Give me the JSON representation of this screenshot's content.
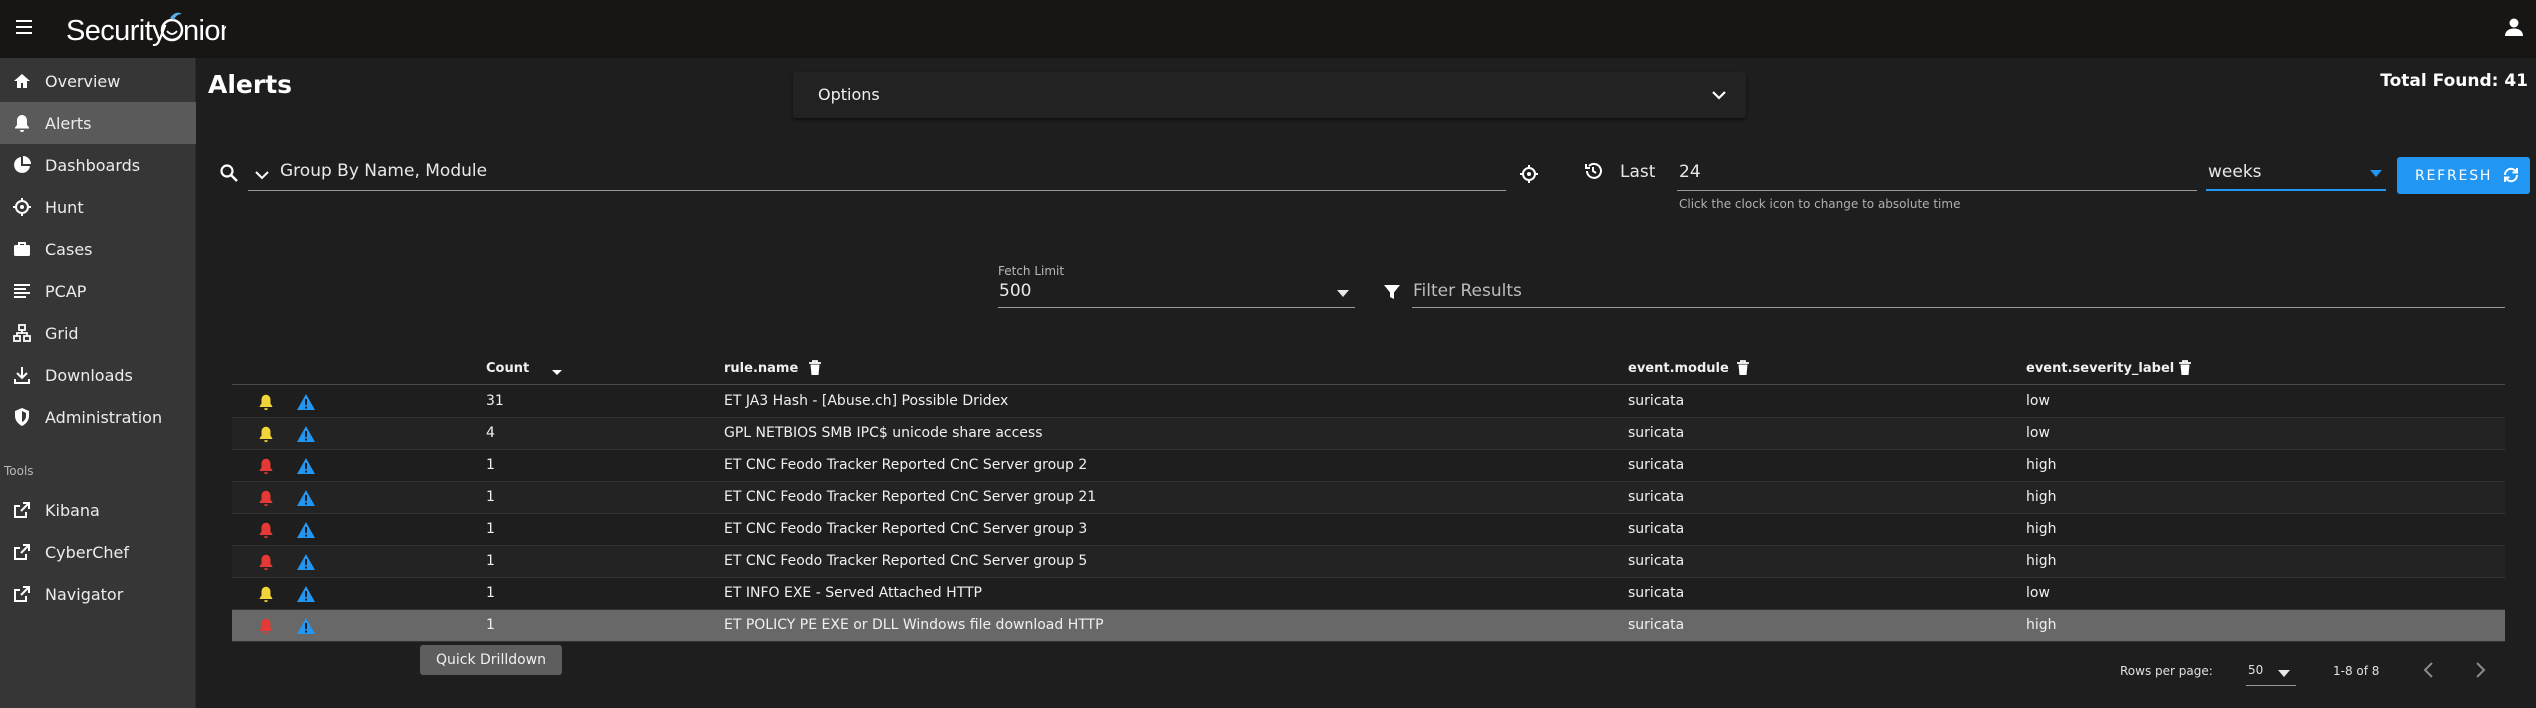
{
  "app": {
    "brand": "Security Onion"
  },
  "sidebar": {
    "items": [
      {
        "label": "Overview",
        "icon": "home-icon"
      },
      {
        "label": "Alerts",
        "icon": "bell-icon"
      },
      {
        "label": "Dashboards",
        "icon": "pie-chart-icon"
      },
      {
        "label": "Hunt",
        "icon": "crosshair-icon"
      },
      {
        "label": "Cases",
        "icon": "briefcase-icon"
      },
      {
        "label": "PCAP",
        "icon": "list-icon"
      },
      {
        "label": "Grid",
        "icon": "grid-icon"
      },
      {
        "label": "Downloads",
        "icon": "download-icon"
      },
      {
        "label": "Administration",
        "icon": "shield-icon"
      }
    ],
    "tools_heading": "Tools",
    "tools": [
      {
        "label": "Kibana",
        "icon": "external-link-icon"
      },
      {
        "label": "CyberChef",
        "icon": "external-link-icon"
      },
      {
        "label": "Navigator",
        "icon": "external-link-icon"
      }
    ]
  },
  "page": {
    "title": "Alerts",
    "total_found": "Total Found: 41"
  },
  "options": {
    "label": "Options"
  },
  "query": {
    "value": "Group By Name, Module"
  },
  "time": {
    "last_label": "Last",
    "value": "24",
    "unit": "weeks",
    "hint": "Click the clock icon to change to absolute time"
  },
  "refresh": {
    "label": "REFRESH"
  },
  "fetch": {
    "label": "Fetch Limit",
    "value": "500"
  },
  "filter": {
    "placeholder": "Filter Results"
  },
  "table": {
    "headers": {
      "count": "Count",
      "rule_name": "rule.name",
      "module": "event.module",
      "severity": "event.severity_label"
    },
    "rows": [
      {
        "count": "31",
        "rule": "ET JA3 Hash - [Abuse.ch] Possible Dridex",
        "module": "suricata",
        "severity": "low",
        "bell": "yellow"
      },
      {
        "count": "4",
        "rule": "GPL NETBIOS SMB IPC$ unicode share access",
        "module": "suricata",
        "severity": "low",
        "bell": "yellow"
      },
      {
        "count": "1",
        "rule": "ET CNC Feodo Tracker Reported CnC Server group 2",
        "module": "suricata",
        "severity": "high",
        "bell": "red"
      },
      {
        "count": "1",
        "rule": "ET CNC Feodo Tracker Reported CnC Server group 21",
        "module": "suricata",
        "severity": "high",
        "bell": "red"
      },
      {
        "count": "1",
        "rule": "ET CNC Feodo Tracker Reported CnC Server group 3",
        "module": "suricata",
        "severity": "high",
        "bell": "red"
      },
      {
        "count": "1",
        "rule": "ET CNC Feodo Tracker Reported CnC Server group 5",
        "module": "suricata",
        "severity": "high",
        "bell": "red"
      },
      {
        "count": "1",
        "rule": "ET INFO EXE - Served Attached HTTP",
        "module": "suricata",
        "severity": "low",
        "bell": "yellow"
      },
      {
        "count": "1",
        "rule": "ET POLICY PE EXE or DLL Windows file download HTTP",
        "module": "suricata",
        "severity": "high",
        "bell": "red"
      }
    ]
  },
  "tooltip": {
    "text": "Quick Drilldown"
  },
  "pagination": {
    "rows_per_page_label": "Rows per page:",
    "rows_per_page": "50",
    "range": "1-8 of 8"
  },
  "colors": {
    "accent": "#2196f3",
    "bell_low": "#f2d43b",
    "bell_high": "#e53935",
    "warn_icon": "#2196f3"
  }
}
